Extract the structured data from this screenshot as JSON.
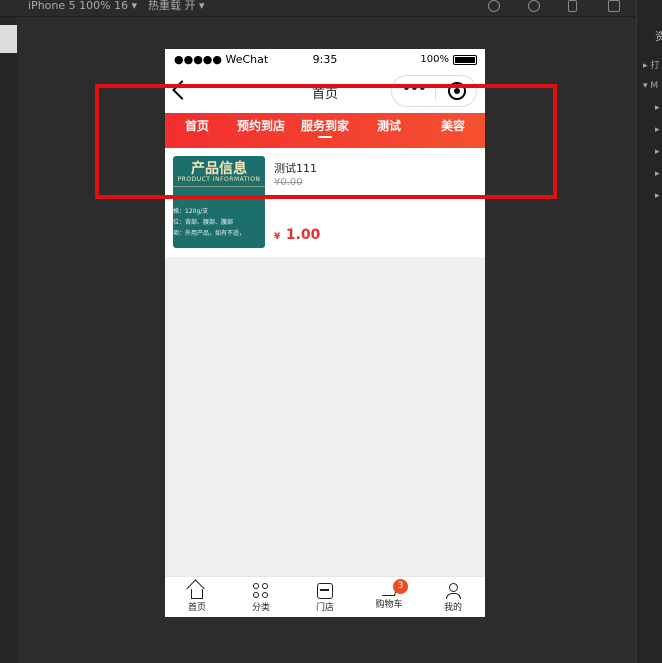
{
  "devtools": {
    "device": "iPhone 5 100% 16 ▾",
    "hot_reload": "热重载 开 ▾",
    "panel_title": "资",
    "panel_rows": [
      "▸ 打",
      "▾ M",
      "▸",
      "▸",
      "▸",
      "▸",
      "▸"
    ]
  },
  "status_bar": {
    "carrier": "●●●●● WeChat",
    "time": "9:35",
    "battery": "100%"
  },
  "navbar": {
    "title": "首页",
    "capsule_more": "•••"
  },
  "tabs": [
    {
      "label": "首页"
    },
    {
      "label": "预约到店"
    },
    {
      "label": "服务到家"
    },
    {
      "label": "测试"
    },
    {
      "label": "美容"
    }
  ],
  "product": {
    "image_title": "产品信息",
    "image_subtitle": "PRODUCT INFORMATION",
    "image_lines": [
      "格：120g/支",
      "位：背部、腰部、腹部",
      "项：外用产品，如有不适，"
    ],
    "name": "测试111",
    "original_price": "¥0.00",
    "currency": "¥",
    "price": "1.00"
  },
  "tabbar": [
    {
      "label": "首页",
      "icon": "home-icon"
    },
    {
      "label": "分类",
      "icon": "category-icon"
    },
    {
      "label": "门店",
      "icon": "store-icon"
    },
    {
      "label": "购物车",
      "icon": "cart-icon",
      "badge": "3"
    },
    {
      "label": "我的",
      "icon": "user-icon"
    }
  ],
  "colors": {
    "tab_gradient_start": "#f22e2e",
    "tab_gradient_end": "#f55030",
    "price": "#e5322b",
    "badge": "#f04a24",
    "highlight": "#e01010"
  }
}
